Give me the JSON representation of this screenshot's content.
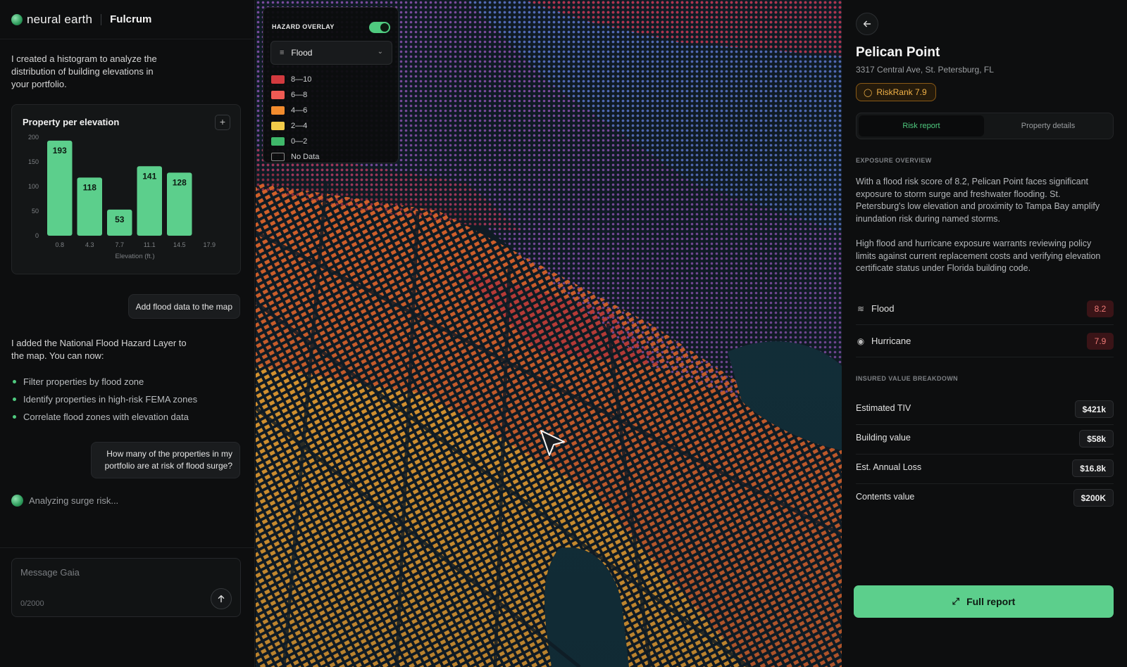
{
  "brand": {
    "name": "neural earth",
    "product": "Fulcrum"
  },
  "chat": {
    "assistant_msg_1": "I created a histogram to analyze the distribution of building elevations in your portfolio.",
    "user_msg_1": "Add flood data to the map",
    "assistant_msg_2": "I added the National Flood Hazard Layer to the map. You can now:",
    "bullets": [
      "Filter properties by flood zone",
      "Identify properties in high-risk FEMA zones",
      "Correlate flood zones with elevation data"
    ],
    "user_msg_2": "How many of the properties in my portfolio are at risk of flood surge?",
    "status": "Analyzing surge risk...",
    "input_placeholder": "Message Gaia",
    "char_count": "0/2000"
  },
  "chart_data": {
    "type": "bar",
    "title": "Property per elevation",
    "xlabel": "Elevation (ft.)",
    "ylabel": "",
    "categories": [
      "0.8",
      "4.3",
      "7.7",
      "11.1",
      "14.5",
      "17.9"
    ],
    "values": [
      193,
      118,
      53,
      141,
      128
    ],
    "ylim": [
      0,
      200
    ],
    "yticks": [
      0,
      50,
      100,
      150,
      200
    ],
    "bar_color": "#5ccf8c",
    "bar_label_color": "#0d1a12"
  },
  "hazard_overlay": {
    "title": "HAZARD OVERLAY",
    "enabled": true,
    "selected_layer": "Flood",
    "legend": [
      {
        "label": "8—10",
        "color": "#d23a3f"
      },
      {
        "label": "6—8",
        "color": "#ef5b54"
      },
      {
        "label": "4—6",
        "color": "#f28c2e"
      },
      {
        "label": "2—4",
        "color": "#f3cc4a"
      },
      {
        "label": "0—2",
        "color": "#3fb86a"
      },
      {
        "label": "No Data",
        "color": ""
      }
    ]
  },
  "property": {
    "name": "Pelican Point",
    "address": "3317 Central Ave, St. Petersburg, FL",
    "riskrank": "RiskRank 7.9",
    "tabs": {
      "risk": "Risk report",
      "details": "Property details"
    },
    "exposure_label": "EXPOSURE OVERVIEW",
    "exposure_p1": "With a flood risk score of 8.2, Pelican Point faces significant exposure to storm surge and freshwater flooding. St. Petersburg's low elevation and proximity to Tampa Bay amplify inundation risk during named storms.",
    "exposure_p2": "High flood and hurricane exposure warrants reviewing policy limits against current replacement costs and verifying elevation certificate status under Florida building code.",
    "risks": [
      {
        "label": "Flood",
        "score": "8.2"
      },
      {
        "label": "Hurricane",
        "score": "7.9"
      }
    ],
    "insured_label": "INSURED VALUE BREAKDOWN",
    "values": [
      {
        "label": "Estimated TIV",
        "value": "$421k"
      },
      {
        "label": "Building value",
        "value": "$58k"
      },
      {
        "label": "Est. Annual Loss",
        "value": "$16.8k"
      },
      {
        "label": "Contents value",
        "value": "$200K"
      }
    ],
    "full_report": "Full report"
  }
}
